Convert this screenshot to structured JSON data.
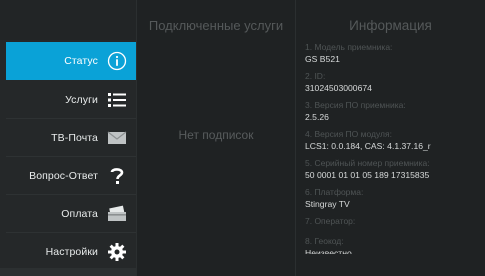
{
  "sidebar": {
    "items": [
      {
        "label": "Статус",
        "icon": "info-icon",
        "active": true
      },
      {
        "label": "Услуги",
        "icon": "list-icon",
        "active": false
      },
      {
        "label": "ТВ-Почта",
        "icon": "envelope-icon",
        "active": false
      },
      {
        "label": "Вопрос-Ответ",
        "icon": "question-icon",
        "active": false
      },
      {
        "label": "Оплата",
        "icon": "payment-card-icon",
        "active": false
      },
      {
        "label": "Настройки",
        "icon": "gear-icon",
        "active": false
      }
    ]
  },
  "services": {
    "title": "Подключенные услуги",
    "empty_text": "Нет подписок"
  },
  "info": {
    "title": "Информация",
    "rows": [
      {
        "label": "1. Модель приемника:",
        "value": "GS B521"
      },
      {
        "label": "2. ID:",
        "value": "31024503000674"
      },
      {
        "label": "3. Версия ПО приемника:",
        "value": "2.5.26"
      },
      {
        "label": "4. Версия ПО модуля:",
        "value": "LCS1: 0.0.184, CAS: 4.1.37.16_r"
      },
      {
        "label": "5. Серийный номер приемника:",
        "value": "50 0001 01 01 05 189 17315835"
      },
      {
        "label": "6. Платформа:",
        "value": "Stingray TV"
      },
      {
        "label": "7. Оператор:",
        "value": ""
      },
      {
        "label": "8. Геокод:",
        "value": "Неизвестно"
      }
    ]
  },
  "colors": {
    "accent": "#0aa2d7",
    "background": "#1f2223",
    "sidebar": "#252829"
  }
}
